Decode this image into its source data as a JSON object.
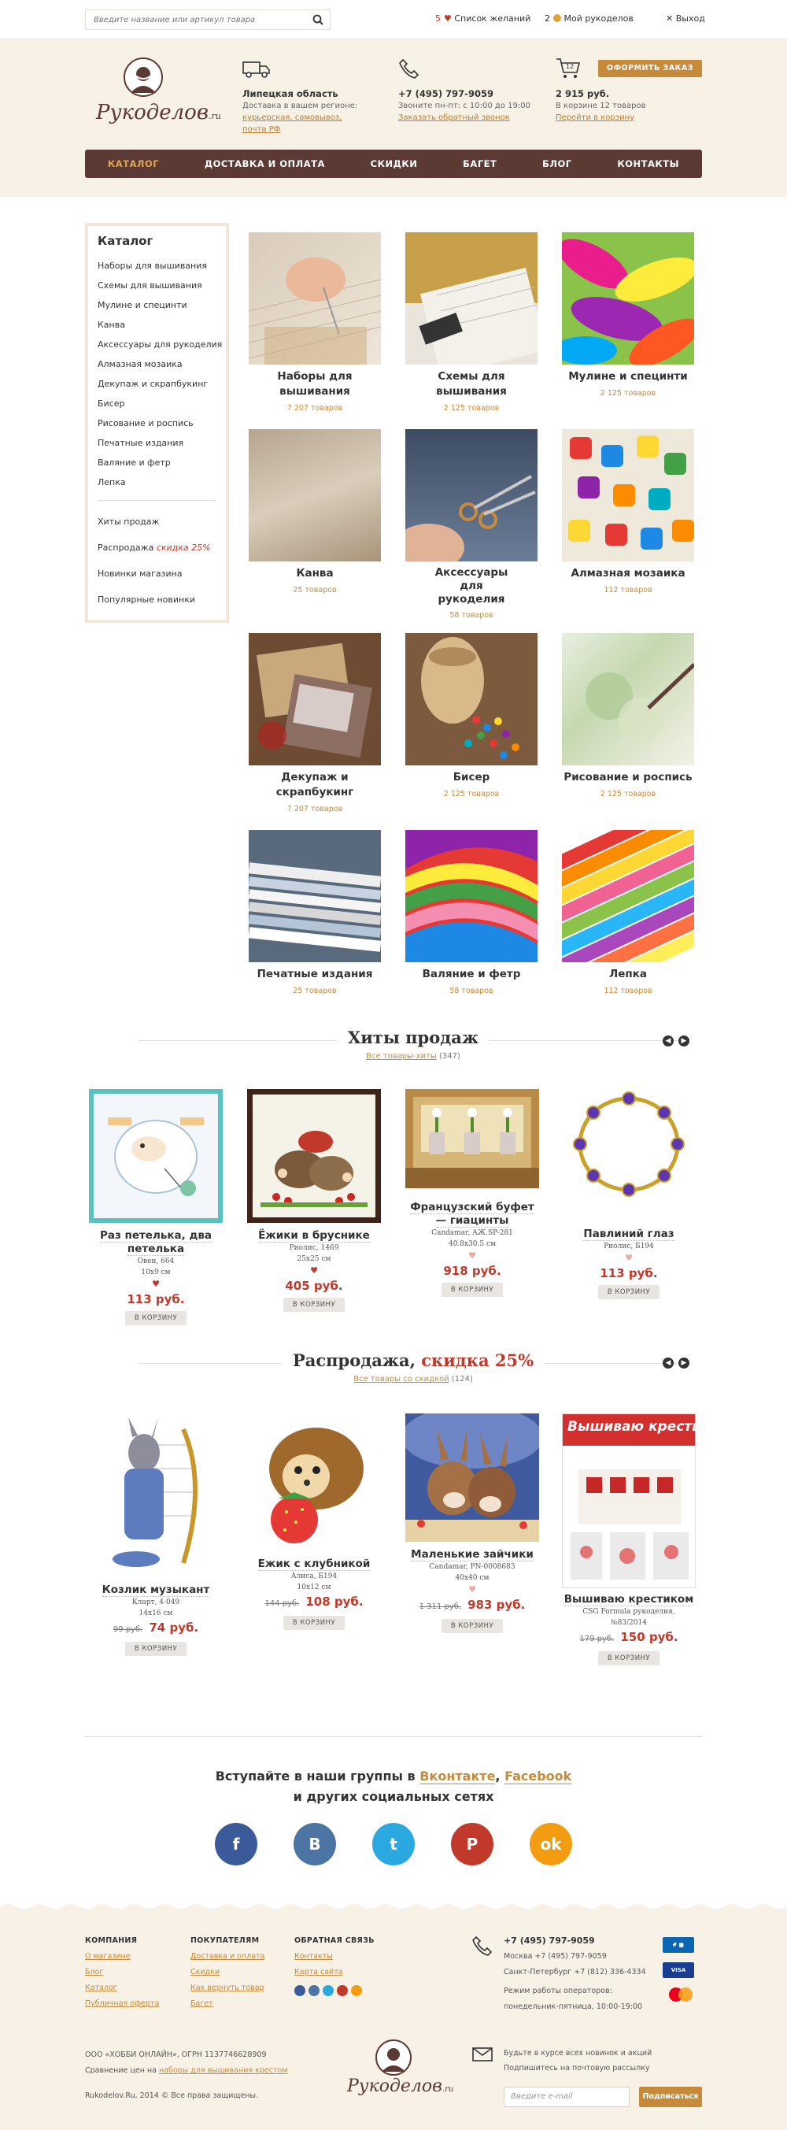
{
  "topbar": {
    "search_placeholder": "Введите название или артикул товара",
    "wishlist_count": "5",
    "wishlist_label": "Список желаний",
    "my_count": "2",
    "my_label": "Мой рукоделов",
    "logout_label": "Выход"
  },
  "header": {
    "logo_text": "Рукоделов",
    "logo_suffix": ".ru",
    "region_title": "Липецкая область",
    "region_line": "Доставка в вашем регионе:",
    "region_links": "курьерская, самовывоз, почта РФ",
    "phone": "+7 (495) 797-9059",
    "phone_hours": "Звоните пн-пт: с 10:00 до 19:00",
    "callback": "Заказать обратный звонок",
    "cart_count": "12",
    "order_button": "ОФОРМИТЬ ЗАКАЗ",
    "cart_sum": "2 915 руб.",
    "cart_items": "В корзине 12 товаров",
    "cart_link": "Перейти в корзину"
  },
  "nav": [
    "КАТАЛОГ",
    "ДОСТАВКА И ОПЛАТА",
    "СКИДКИ",
    "БАГЕТ",
    "БЛОГ",
    "КОНТАКТЫ"
  ],
  "sidebar": {
    "title": "Каталог",
    "items": [
      "Наборы для вышивания",
      "Схемы для вышивания",
      "Мулине и специнти",
      "Канва",
      "Аксессуары для рукоделия",
      "Алмазная мозаика",
      "Декупаж и скрапбукинг",
      "Бисер",
      "Рисование и роспись",
      "Печатные издания",
      "Валяние и фетр",
      "Лепка"
    ],
    "hits": "Хиты продаж",
    "sale_prefix": "Распродажа",
    "sale_hot": "скидка 25%",
    "new_store": "Новинки магазина",
    "popular_new": "Популярные новинки"
  },
  "categories": [
    {
      "name": "Наборы для вышивания",
      "count": "7 207 товаров"
    },
    {
      "name": "Схемы для вышивания",
      "count": "2 125 товаров"
    },
    {
      "name": "Мулине и специнти",
      "count": "2 125 товаров"
    },
    {
      "name": "Канва",
      "count": "25 товаров"
    },
    {
      "name": "Аксессуары для рукоделия",
      "count": "58 товаров"
    },
    {
      "name": "Алмазная мозаика",
      "count": "112 товаров"
    },
    {
      "name": "Декупаж и скрапбукинг",
      "count": "7 207 товаров"
    },
    {
      "name": "Бисер",
      "count": "2 125 товаров"
    },
    {
      "name": "Рисование и роспись",
      "count": "2 125 товаров"
    },
    {
      "name": "Печатные издания",
      "count": "25 товаров"
    },
    {
      "name": "Валяние и фетр",
      "count": "58 товаров"
    },
    {
      "name": "Лепка",
      "count": "112 товаров"
    }
  ],
  "hits": {
    "title": "Хиты продаж",
    "link": "Все товары-хиты",
    "count": "(347)",
    "products": [
      {
        "name": "Раз петелька, два петелька",
        "brand": "Овен, 664",
        "size": "10х9 см",
        "price": "113 руб.",
        "btn": "В КОРЗИНУ"
      },
      {
        "name": "Ёжики в бруснике",
        "brand": "Риолис, 1469",
        "size": "25х25 см",
        "price": "405 руб.",
        "btn": "В КОРЗИНУ"
      },
      {
        "name": "Французский буфет — гиацинты",
        "brand": "Candamar, АЖ.SP-281",
        "size": "40.8х30.5 см",
        "price": "918 руб.",
        "btn": "В КОРЗИНУ"
      },
      {
        "name": "Павлиний глаз",
        "brand": "Риолис, Б194",
        "size": "",
        "price": "113 руб.",
        "btn": "В КОРЗИНУ"
      }
    ]
  },
  "sale": {
    "title_prefix": "Распродажа,",
    "title_hot": "скидка 25%",
    "link": "Все товары со скидкой",
    "count": "(124)",
    "products": [
      {
        "name": "Козлик музыкант",
        "brand": "Кларт, 4-049",
        "size": "14х16 см",
        "old": "99 руб.",
        "price": "74 руб.",
        "btn": "В КОРЗИНУ"
      },
      {
        "name": "Ежик с клубникой",
        "brand": "Алиса, Б194",
        "size": "10х12 см",
        "old": "144 руб.",
        "price": "108 руб.",
        "btn": "В КОРЗИНУ"
      },
      {
        "name": "Маленькие зайчики",
        "brand": "Candamar, PN-0008683",
        "size": "40х40 см",
        "old": "1 311 руб.",
        "price": "983 руб.",
        "btn": "В КОРЗИНУ"
      },
      {
        "name": "Вышиваю крестиком",
        "brand": "CSG Formula рукоделия,",
        "size": "№83/2014",
        "old": "179 руб.",
        "price": "150 руб.",
        "btn": "В КОРЗИНУ"
      }
    ]
  },
  "social": {
    "line1_prefix": "Вступайте в наши группы в",
    "vk": "Вконтакте",
    "fb": "Facebook",
    "line2": "и других социальных сетях"
  },
  "footer": {
    "col1_title": "КОМПАНИЯ",
    "col1": [
      "О магазине",
      "Блог",
      "Каталог",
      "Публичная оферта"
    ],
    "col2_title": "ПОКУПАТЕЛЯМ",
    "col2": [
      "Доставка и оплата",
      "Скидки",
      "Как вернуть товар",
      "Багет"
    ],
    "col3_title": "ОБРАТНАЯ СВЯЗЬ",
    "col3": [
      "Контакты",
      "Карта сайта"
    ],
    "phone": "+7 (495) 797-9059",
    "msk": "Москва +7 (495) 797-9059",
    "spb": "Санкт-Петербург +7 (812) 336-4334",
    "hours1": "Режим работы операторов:",
    "hours2": "понедельник-пятница, 10:00-19:00",
    "company": "ООО «ХОББИ ОНЛАЙН», ОГРН 1137746628909",
    "compare_prefix": "Сравнение цен на",
    "compare_link": "наборы для вышивания крестом",
    "copyright": "Rukodelov.Ru, 2014 © Все права защищены.",
    "news1": "Будьте в курсе всех новинок и акций",
    "news2": "Подпишитесь на почтовую рассылку",
    "email_placeholder": "Введите e-mail",
    "subscribe": "Подписаться"
  }
}
